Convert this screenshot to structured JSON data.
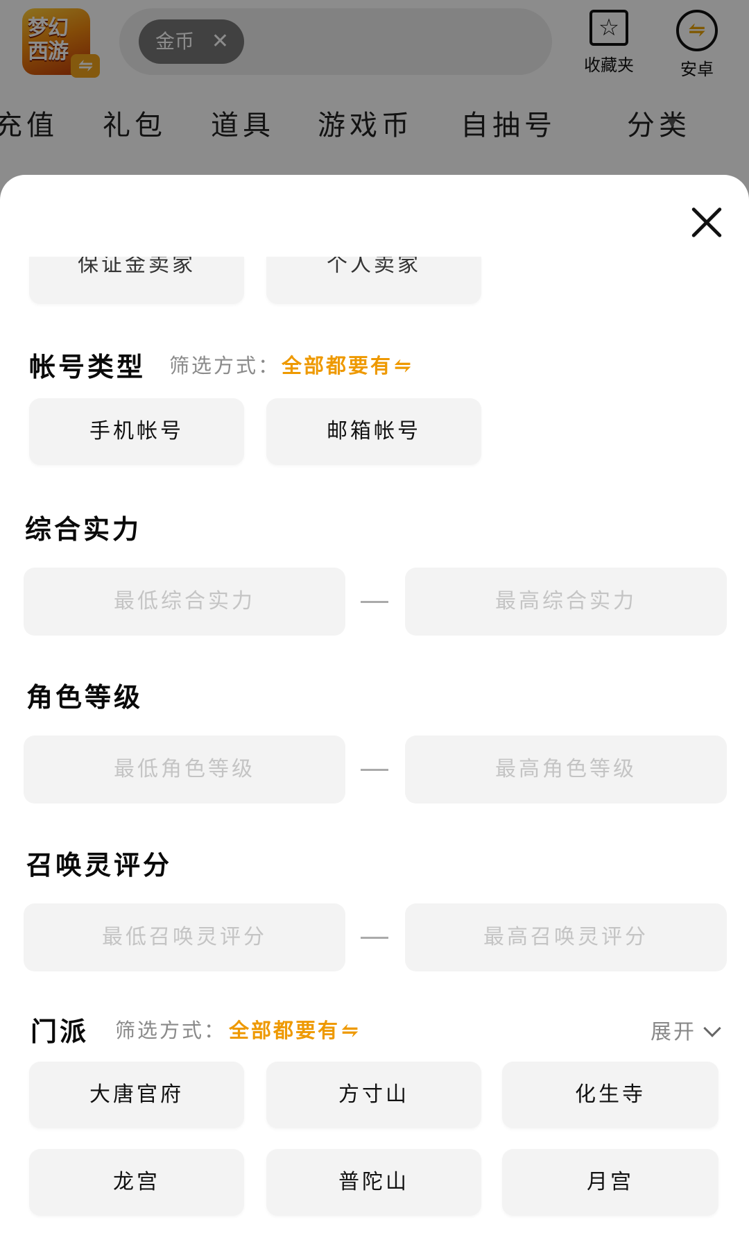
{
  "header": {
    "logo_text": "梦幻西游",
    "search_chip": "金币",
    "favorites_label": "收藏夹",
    "platform_label": "安卓"
  },
  "categories": [
    "充值",
    "礼包",
    "道具",
    "游戏币",
    "自抽号",
    "分类"
  ],
  "sheet": {
    "seller_options": [
      "保证金卖家",
      "个人卖家"
    ],
    "account_type": {
      "title": "帐号类型",
      "filter_label": "筛选方式：",
      "filter_value": "全部都要有",
      "options": [
        "手机帐号",
        "邮箱帐号"
      ]
    },
    "power": {
      "title": "综合实力",
      "min_placeholder": "最低综合实力",
      "max_placeholder": "最高综合实力"
    },
    "level": {
      "title": "角色等级",
      "min_placeholder": "最低角色等级",
      "max_placeholder": "最高角色等级"
    },
    "pet_score": {
      "title": "召唤灵评分",
      "min_placeholder": "最低召唤灵评分",
      "max_placeholder": "最高召唤灵评分"
    },
    "school": {
      "title": "门派",
      "filter_label": "筛选方式：",
      "filter_value": "全部都要有",
      "expand_label": "展开",
      "options": [
        "大唐官府",
        "方寸山",
        "化生寺",
        "龙宫",
        "普陀山",
        "月宫"
      ]
    }
  }
}
